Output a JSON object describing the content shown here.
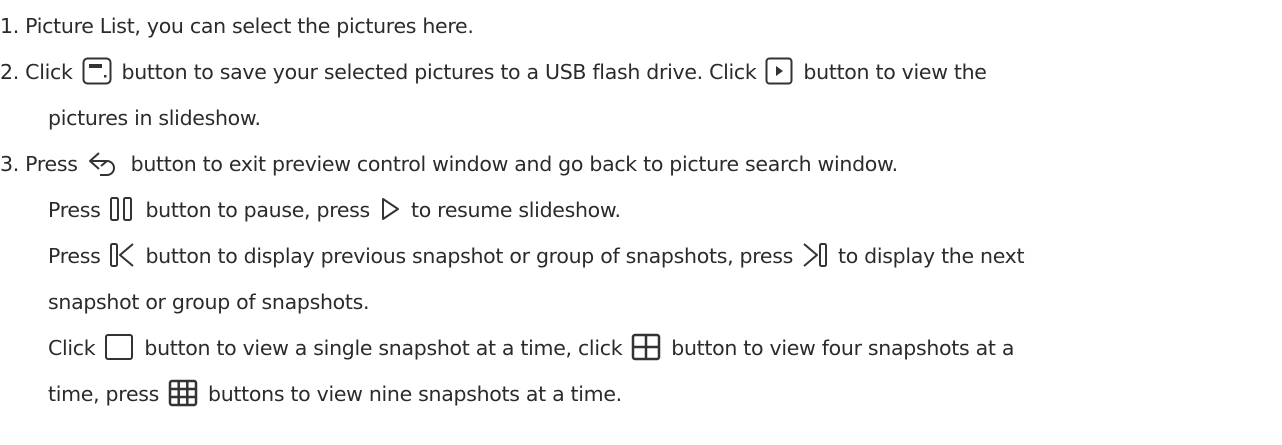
{
  "items": {
    "item1": {
      "text": "1. Picture List, you can select the pictures here."
    },
    "item2": {
      "a": "2. Click",
      "b": "button to save your selected pictures to a USB flash drive. Click",
      "c": "button to view the",
      "d": "pictures in slideshow."
    },
    "item3": {
      "a": "3. Press",
      "b": "button to exit preview control window and go back to picture search window.",
      "c": "Press",
      "d": "button to pause, press",
      "e": "to resume slideshow.",
      "f": "Press",
      "g": "button to display previous snapshot or group of snapshots, press",
      "h": "to display the next",
      "i": "snapshot or group of snapshots.",
      "j": "Click",
      "k": "button to view a single snapshot at a time, click",
      "l": "button to view four snapshots at a",
      "m": "time, press",
      "n": "buttons to view nine snapshots at a time."
    }
  },
  "icons": {
    "save": "save-to-usb-icon",
    "play_box": "play-slideshow-icon",
    "back": "back-arrow-icon",
    "pause": "pause-icon",
    "resume": "play-triangle-icon",
    "previous": "previous-icon",
    "next": "next-icon",
    "single": "single-view-icon",
    "four": "four-view-icon",
    "nine": "nine-view-icon"
  },
  "colors": {
    "text": "#2b2b2b",
    "icon": "#333333"
  }
}
